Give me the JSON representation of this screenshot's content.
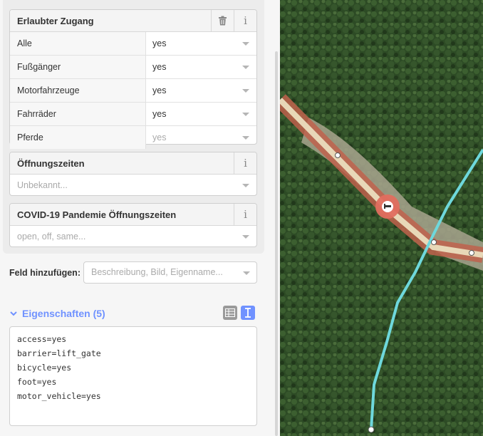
{
  "access_field": {
    "title": "Erlaubter Zugang",
    "rows": [
      {
        "label": "Alle",
        "value": "yes",
        "placeholder": false
      },
      {
        "label": "Fußgänger",
        "value": "yes",
        "placeholder": false
      },
      {
        "label": "Motorfahrzeuge",
        "value": "yes",
        "placeholder": false
      },
      {
        "label": "Fahrräder",
        "value": "yes",
        "placeholder": false
      },
      {
        "label": "Pferde",
        "value": "yes",
        "placeholder": true
      }
    ]
  },
  "opening_hours": {
    "title": "Öffnungszeiten",
    "placeholder": "Unbekannt..."
  },
  "covid_hours": {
    "title": "COVID-19 Pandemie Öffnungszeiten",
    "placeholder": "open, off, same..."
  },
  "add_field": {
    "label": "Feld hinzufügen:",
    "placeholder": "Beschreibung, Bild, Eigenname..."
  },
  "properties": {
    "title": "Eigenschaften (5)",
    "tags": [
      "access=yes",
      "barrier=lift_gate",
      "bicycle=yes",
      "foot=yes",
      "motor_vehicle=yes"
    ]
  },
  "icons": {
    "delete": "trash-icon",
    "info": "info-icon",
    "list_view": "table-view-icon",
    "text_view": "text-view-icon",
    "map_marker": "lift-gate-icon"
  },
  "colors": {
    "accent": "#7092ff",
    "marker": "#e06e5f",
    "path": "#6ed8dc",
    "road": "#e8d8b8"
  }
}
